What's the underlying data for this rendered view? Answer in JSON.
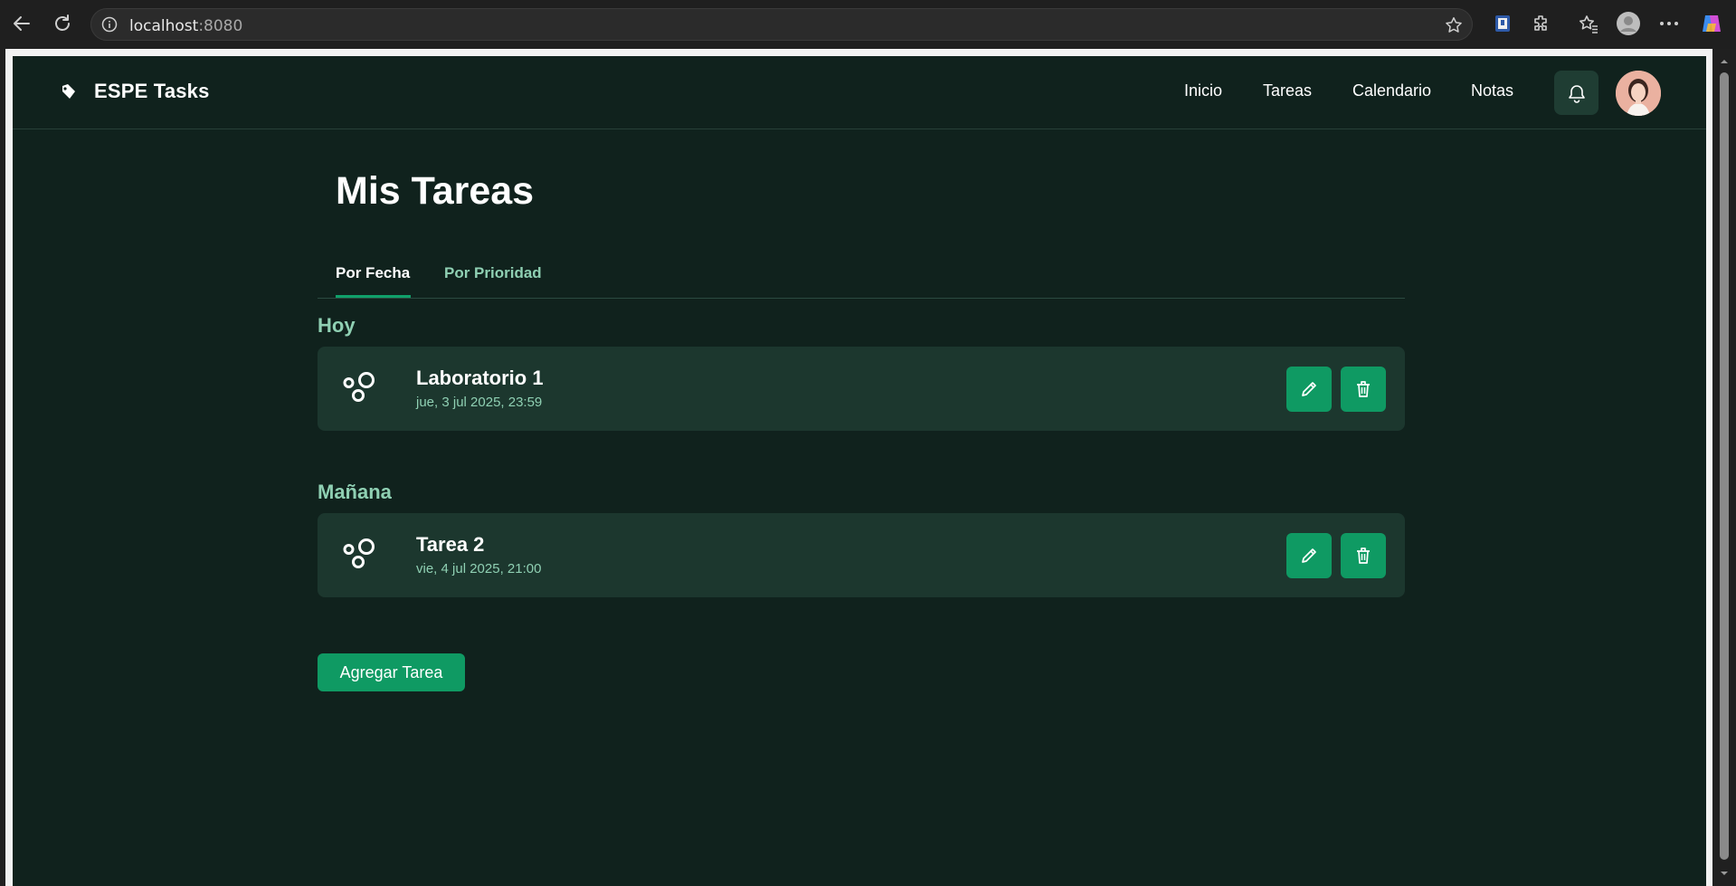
{
  "browser": {
    "url_host": "localhost",
    "url_port": ":8080",
    "icons": [
      "back-icon",
      "reload-icon",
      "info-icon",
      "star-icon",
      "extension-icon",
      "puzzle-icon",
      "favorites-icon",
      "profile-icon",
      "more-icon",
      "copilot-icon"
    ]
  },
  "app": {
    "brand": "ESPE Tasks",
    "nav": [
      {
        "label": "Inicio"
      },
      {
        "label": "Tareas"
      },
      {
        "label": "Calendario"
      },
      {
        "label": "Notas"
      }
    ]
  },
  "main": {
    "title": "Mis Tareas",
    "tabs": [
      {
        "label": "Por Fecha",
        "active": true
      },
      {
        "label": "Por Prioridad",
        "active": false
      }
    ],
    "groups": [
      {
        "title": "Hoy",
        "tasks": [
          {
            "title": "Laboratorio 1",
            "date": "jue, 3 jul 2025, 23:59"
          }
        ]
      },
      {
        "title": "Mañana",
        "tasks": [
          {
            "title": "Tarea 2",
            "date": "vie, 4 jul 2025, 21:00"
          }
        ]
      }
    ],
    "add_button": "Agregar Tarea"
  },
  "colors": {
    "background": "#10221d",
    "card": "#1c372e",
    "accent": "#0f9a63",
    "muted_text": "#8fd0b3"
  }
}
